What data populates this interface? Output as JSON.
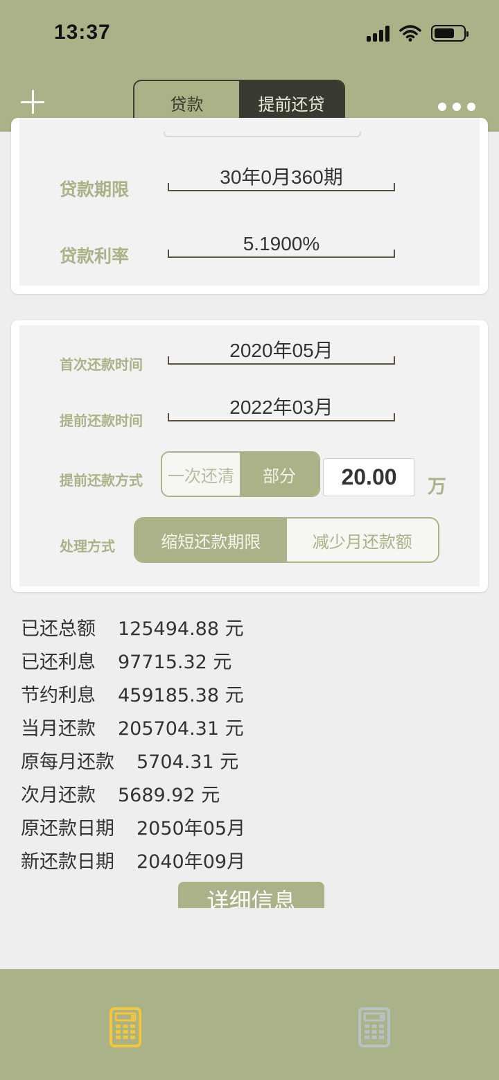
{
  "status_bar": {
    "time": "13:37"
  },
  "nav": {
    "tabs": [
      {
        "label": "贷款",
        "selected": false
      },
      {
        "label": "提前还贷",
        "selected": true
      }
    ]
  },
  "loan_card": {
    "term_label": "贷款期限",
    "term_value": "30年0月360期",
    "rate_label": "贷款利率",
    "rate_value": "5.1900%"
  },
  "prepay_card": {
    "first_payment_label": "首次还款时间",
    "first_payment_value": "2020年05月",
    "prepay_time_label": "提前还款时间",
    "prepay_time_value": "2022年03月",
    "prepay_method_label": "提前还款方式",
    "prepay_methods": [
      {
        "label": "一次还清",
        "selected": false
      },
      {
        "label": "部分",
        "selected": true
      }
    ],
    "amount_value": "20.00",
    "amount_unit": "万",
    "process_label": "处理方式",
    "process_options": [
      {
        "label": "缩短还款期限",
        "selected": true
      },
      {
        "label": "减少月还款额",
        "selected": false
      }
    ]
  },
  "results": [
    {
      "label": "已还总额",
      "value": "125494.88 元"
    },
    {
      "label": "已还利息",
      "value": "97715.32 元"
    },
    {
      "label": "节约利息",
      "value": "459185.38 元"
    },
    {
      "label": "当月还款",
      "value": "205704.31 元"
    },
    {
      "label": "原每月还款",
      "value": "5704.31 元"
    },
    {
      "label": "次月还款",
      "value": "5689.92 元"
    },
    {
      "label": "原还款日期",
      "value": "2050年05月"
    },
    {
      "label": "新还款日期",
      "value": "2040年09月"
    }
  ],
  "detail_button_label": "详细信息",
  "tab_bar": {
    "items": [
      {
        "icon": "calculator-icon",
        "active": true,
        "color": "#f5c53a"
      },
      {
        "icon": "calculator-icon",
        "active": false,
        "color": "#b6c2c4"
      }
    ]
  },
  "colors": {
    "accent": "#a9b387",
    "dark_segment": "#383a30"
  }
}
